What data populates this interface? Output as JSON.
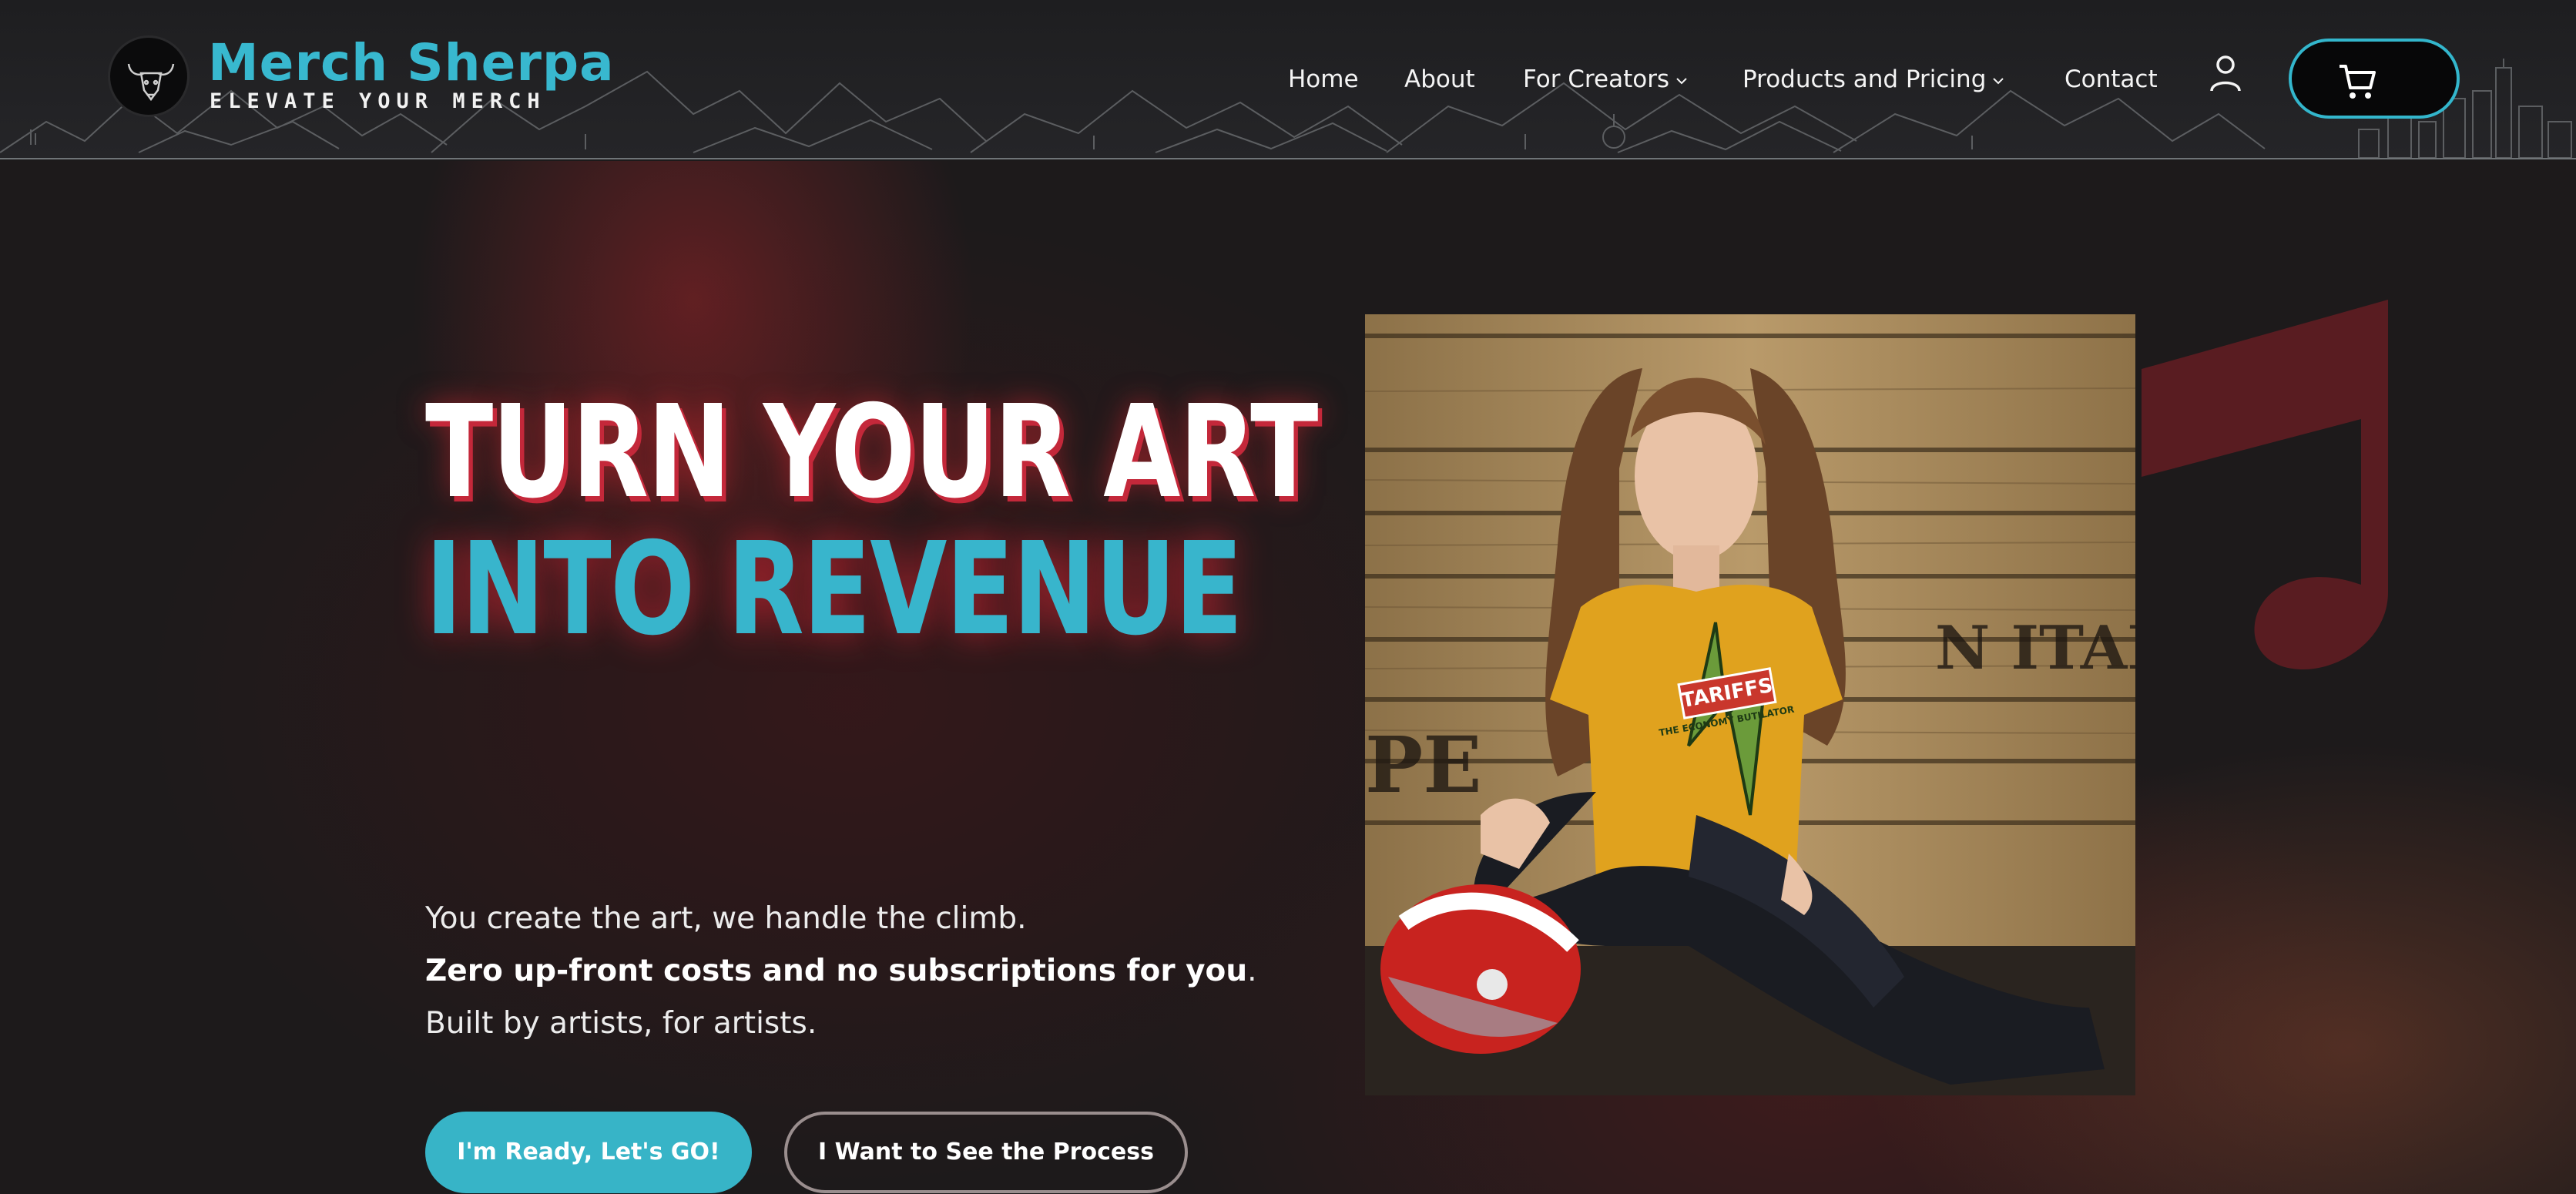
{
  "brand": {
    "name": "Merch Sherpa",
    "tagline": "ELEVATE YOUR MERCH",
    "logo_icon": "bull-head-icon",
    "accent_color": "#38b8cf"
  },
  "nav": {
    "items": [
      {
        "label": "Home"
      },
      {
        "label": "About"
      },
      {
        "label": "For Creators",
        "has_dropdown": true
      },
      {
        "label": "Products and Pricing",
        "has_dropdown": true
      },
      {
        "label": "Contact"
      }
    ],
    "account_icon": "user-icon",
    "cart_icon": "cart-icon"
  },
  "hero": {
    "headline_line1": "TURN YOUR ART",
    "headline_line2": "INTO REVENUE",
    "body_line1": "You create the art, we handle the climb.",
    "body_line2_bold": "Zero up-front costs and no subscriptions for you",
    "body_line2_end": ".",
    "body_line3": "Built by artists, for artists.",
    "primary_button": "I'm Ready, Let's GO!",
    "secondary_button": "I Want to See the Process",
    "photo": {
      "tee_graphic_title": "TARIFFS",
      "tee_graphic_subtitle": "THE ECONOMY BUTILATOR",
      "crate_text_1": "N ITALI",
      "crate_text_2": "PE"
    },
    "decor_icon": "music-note-icon"
  },
  "colors": {
    "primary_button": "#37b4c7",
    "headline_shadow": "#c4283a",
    "shirt": "#e0a21e"
  }
}
